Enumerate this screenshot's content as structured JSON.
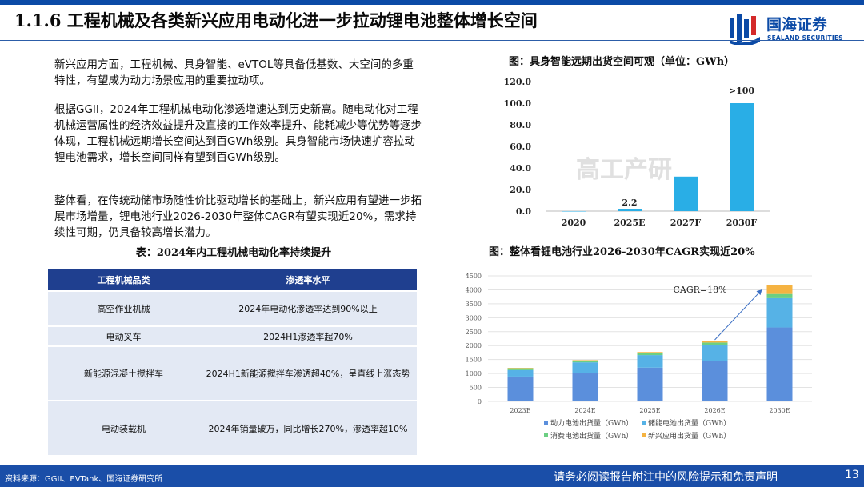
{
  "header": {
    "title": "1.1.6 工程机械及各类新兴应用电动化进一步拉动锂电池整体增长空间",
    "logo_cn": "国海证券",
    "logo_en": "SEALAND SECURITIES"
  },
  "body": {
    "para1": "新兴应用方面，工程机械、具身智能、eVTOL等具备低基数、大空间的多重特性，有望成为动力场景应用的重要拉动项。",
    "para2": "根据GGII，2024年工程机械电动化渗透增速达到历史新高。随电动化对工程机械运营属性的经济效益提升及直接的工作效率提升、能耗减少等优势等逐步体现，工程机械远期增长空间达到百GWh级别。具身智能市场快速扩容拉动锂电池需求，增长空间同样有望到百GWh级别。",
    "para3": "整体看，在传统动储市场随性价比驱动增长的基础上，新兴应用有望进一步拓展市场增量，锂电池行业2026-2030年整体CAGR有望实现近20%，需求持续性可期，仍具备较高增长潜力。"
  },
  "table": {
    "caption": "表：2024年内工程机械电动化率持续提升",
    "headers": [
      "工程机械品类",
      "渗透率水平"
    ],
    "rows": [
      [
        "高空作业机械",
        "2024年电动化渗透率达到90%以上"
      ],
      [
        "电动叉车",
        "2024H1渗透率超70%"
      ],
      [
        "新能源混凝土搅拌车",
        "2024H1新能源搅拌车渗透超40%，呈直线上涨态势"
      ],
      [
        "电动装载机",
        "2024年销量破万，同比增长270%，渗透率超10%"
      ]
    ]
  },
  "chart1_caption": "图：具身智能远期出货空间可观（单位：GWh）",
  "chart2_caption": "图：整体看锂电池行业2026-2030年CAGR实现近20%",
  "watermark": "高工产研",
  "footer": {
    "source": "资料来源：GGII、EVTank、国海证券研究所",
    "notice": "请务必阅读报告附注中的风险提示和免责声明",
    "page": "13"
  },
  "colors": {
    "brand": "#0b4aa6",
    "bar1": "#29aee6",
    "power": "#5b8fdc",
    "storage": "#56b2e6",
    "consumer": "#6ccf83",
    "emerging": "#f5b342"
  },
  "chart_data": [
    {
      "type": "bar",
      "categories": [
        "2020",
        "2025E",
        "2027F",
        "2030F"
      ],
      "values": [
        0,
        2.2,
        32,
        100
      ],
      "data_labels": [
        "",
        "2.2",
        "",
        ">100"
      ],
      "ylim": [
        0,
        120
      ],
      "yticks": [
        "0.0",
        "20.0",
        "40.0",
        "60.0",
        "80.0",
        "100.0",
        "120.0"
      ],
      "grid": false,
      "legend": "none"
    },
    {
      "type": "bar",
      "stacked": true,
      "categories": [
        "2023E",
        "2024E",
        "2025E",
        "2026E",
        "2030E"
      ],
      "series": [
        {
          "name": "动力电池出货量（GWh）",
          "values": [
            890,
            1020,
            1210,
            1450,
            2650
          ]
        },
        {
          "name": "储能电池出货量（GWh）",
          "values": [
            230,
            380,
            450,
            570,
            1050
          ]
        },
        {
          "name": "消费电池出货量（GWh）",
          "values": [
            70,
            70,
            80,
            90,
            150
          ]
        },
        {
          "name": "新兴应用出货量（GWh）",
          "values": [
            10,
            10,
            30,
            40,
            330
          ]
        }
      ],
      "ylim": [
        0,
        4500
      ],
      "yticks": [
        "0",
        "500",
        "1000",
        "1500",
        "2000",
        "2500",
        "3000",
        "3500",
        "4000",
        "4500"
      ],
      "annotation": "CAGR=18%",
      "grid": true,
      "legend": "bottom"
    }
  ]
}
